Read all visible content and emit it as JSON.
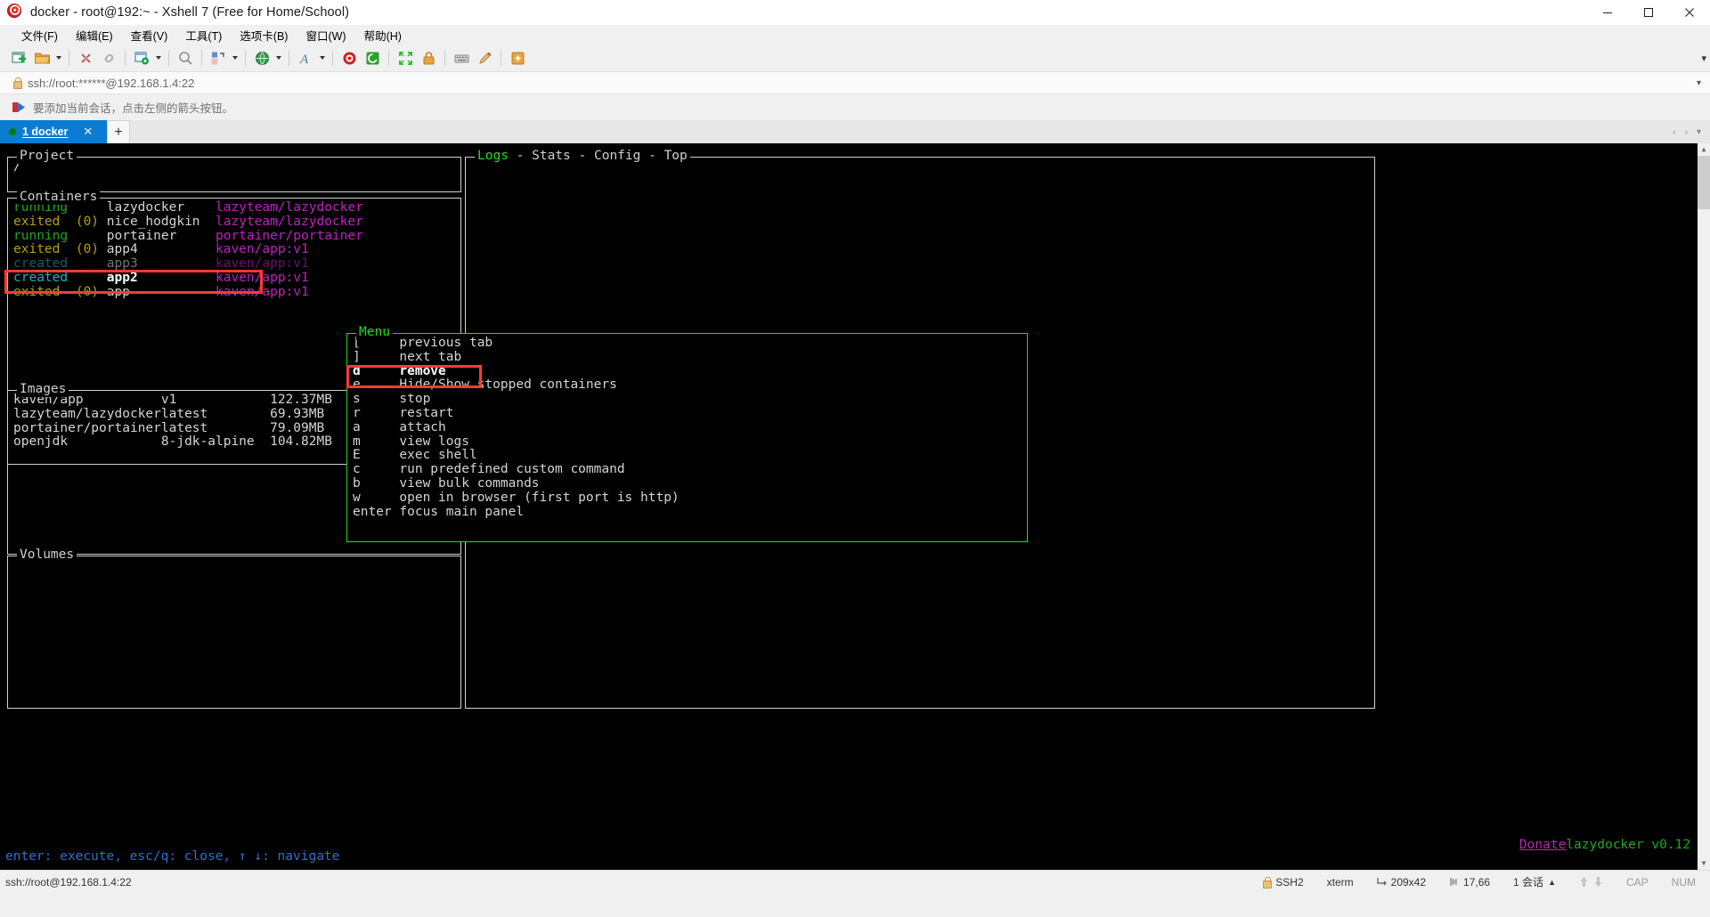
{
  "window": {
    "title": "docker - root@192:~ - Xshell 7 (Free for Home/School)",
    "icon": "xshell-spiral-icon",
    "minimize_label": "─",
    "maximize_label": "□",
    "close_label": "✕"
  },
  "menubar": {
    "items": [
      {
        "label": "文件(F)"
      },
      {
        "label": "编辑(E)"
      },
      {
        "label": "查看(V)"
      },
      {
        "label": "工具(T)"
      },
      {
        "label": "选项卡(B)"
      },
      {
        "label": "窗口(W)"
      },
      {
        "label": "帮助(H)"
      }
    ]
  },
  "toolbar": {
    "overflow_label": "▾",
    "icons": [
      "new-session-icon",
      "open-folder-icon",
      "open-folder-dropdown",
      "disconnect-icon",
      "link-icon",
      "session-properties-icon",
      "session-properties-dropdown",
      "find-icon",
      "layout-icon",
      "layout-dropdown",
      "globe-icon",
      "globe-dropdown",
      "font-icon",
      "font-dropdown",
      "xshell-icon",
      "xftp-icon",
      "fullscreen-icon",
      "lock-icon",
      "keyboard-icon",
      "compose-icon",
      "add-note-icon"
    ]
  },
  "address_bar": {
    "icon": "lock-icon",
    "value": "ssh://root:******@192.168.1.4:22",
    "dropdown_label": "▾"
  },
  "hint_bar": {
    "icon": "red-arrow-icon",
    "text": "要添加当前会话，点击左侧的箭头按钮。"
  },
  "tabs": {
    "active": {
      "status_dot": "connected",
      "label": "1 docker",
      "close_label": "✕"
    },
    "add_label": "+",
    "nav_prev": "‹",
    "nav_next": "›",
    "nav_menu": "▾"
  },
  "terminal": {
    "project": {
      "title": "Project",
      "path": "/"
    },
    "containers": {
      "title": "Containers",
      "rows": [
        {
          "status": "running",
          "code": "",
          "name": "lazydocker",
          "image": "lazyteam/lazydocker",
          "status_color": "green",
          "dim": false,
          "selected": false
        },
        {
          "status": "exited",
          "code": "(0)",
          "name": "nice_hodgkin",
          "image": "lazyteam/lazydocker",
          "status_color": "yellow",
          "dim": false,
          "selected": false
        },
        {
          "status": "running",
          "code": "",
          "name": "portainer",
          "image": "portainer/portainer",
          "status_color": "green",
          "dim": false,
          "selected": false
        },
        {
          "status": "exited",
          "code": "(0)",
          "name": "app4",
          "image": "kaven/app:v1",
          "status_color": "yellow",
          "dim": false,
          "selected": false
        },
        {
          "status": "created",
          "code": "",
          "name": "app3",
          "image": "kaven/app:v1",
          "status_color": "cyan",
          "dim": true,
          "selected": false
        },
        {
          "status": "created",
          "code": "",
          "name": "app2",
          "image": "kaven/app:v1",
          "status_color": "cyan",
          "dim": false,
          "selected": true
        },
        {
          "status": "exited",
          "code": "(0)",
          "name": "app",
          "image": "kaven/app:v1",
          "status_color": "yellow",
          "dim": false,
          "selected": false
        }
      ]
    },
    "images": {
      "title": "Images",
      "rows": [
        {
          "repo": "kaven/app",
          "tag": "v1",
          "size": "122.37MB"
        },
        {
          "repo": "lazyteam/lazydocker",
          "tag": "latest",
          "size": "69.93MB"
        },
        {
          "repo": "portainer/portainer",
          "tag": "latest",
          "size": "79.09MB"
        },
        {
          "repo": "openjdk",
          "tag": "8-jdk-alpine",
          "size": "104.82MB"
        }
      ]
    },
    "volumes": {
      "title": "Volumes",
      "rows": []
    },
    "main_panel": {
      "tabs": [
        {
          "label": "Logs",
          "active": true
        },
        {
          "label": "Stats",
          "active": false
        },
        {
          "label": "Config",
          "active": false
        },
        {
          "label": "Top",
          "active": false
        }
      ],
      "separator": " - "
    },
    "menu": {
      "title": "Menu",
      "items": [
        {
          "key": "[",
          "label": "previous tab",
          "selected": false
        },
        {
          "key": "]",
          "label": "next tab",
          "selected": false
        },
        {
          "key": "d",
          "label": "remove",
          "selected": true
        },
        {
          "key": "e",
          "label": "Hide/Show stopped containers",
          "selected": false
        },
        {
          "key": "s",
          "label": "stop",
          "selected": false
        },
        {
          "key": "r",
          "label": "restart",
          "selected": false
        },
        {
          "key": "a",
          "label": "attach",
          "selected": false
        },
        {
          "key": "m",
          "label": "view logs",
          "selected": false
        },
        {
          "key": "E",
          "label": "exec shell",
          "selected": false
        },
        {
          "key": "c",
          "label": "run predefined custom command",
          "selected": false
        },
        {
          "key": "b",
          "label": "view bulk commands",
          "selected": false
        },
        {
          "key": "w",
          "label": "open in browser (first port is http)",
          "selected": false
        },
        {
          "key": "enter",
          "label": "focus main panel",
          "selected": false
        }
      ]
    },
    "footer": {
      "keybinds": "enter: execute, esc/q: close, ↑ ↓: navigate",
      "donate": "Donate",
      "version": "lazydocker v0.12"
    },
    "scrollbar": {
      "up": "▲",
      "down": "▼"
    }
  },
  "statusbar": {
    "connection": "ssh://root@192.168.1.4:22",
    "security_icon": "lock-icon",
    "security": "SSH2",
    "term_type": "xterm",
    "size_icon": "size-icon",
    "size": "209x42",
    "cursor_icon": "cursor-icon",
    "cursor": "17,66",
    "sessions": "1 会话",
    "sessions_caret": "▲",
    "tx_icon": "upload-arrow-icon",
    "rx_icon": "download-arrow-icon",
    "cap": "CAP",
    "num": "NUM"
  },
  "colors": {
    "accent": "#0a7cd1",
    "highlight_box": "#ff3b30",
    "menu_border": "#22dd22",
    "running": "#1fa81f",
    "exited": "#b8a00a",
    "created": "#1fb0c0",
    "image": "#c020c0"
  }
}
